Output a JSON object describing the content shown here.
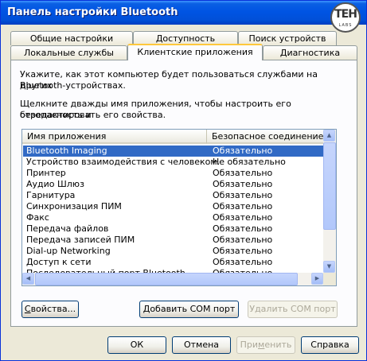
{
  "window": {
    "title": "Панель настройки Bluetooth"
  },
  "logo": {
    "text": "ТЕН",
    "subtext": "LABS"
  },
  "tabs_row1": [
    {
      "label": "Общие настройки"
    },
    {
      "label": "Доступность"
    },
    {
      "label": "Поиск устройств"
    }
  ],
  "tabs_row2": [
    {
      "label": "Локальные службы"
    },
    {
      "label": "Клиентские приложения",
      "active": true
    },
    {
      "label": "Диагностика"
    }
  ],
  "description": {
    "line1": "Укажите, как этот компьютер будет пользоваться службами на других",
    "line2": "Bluetooth-устройствах.",
    "line3": "Щелкните дважды имя приложения, чтобы настроить его безопасность и",
    "line4": "отредактировать его свойства."
  },
  "table": {
    "columns": [
      "Имя приложения",
      "Безопасное соединение"
    ],
    "rows": [
      {
        "name": "Bluetooth Imaging",
        "secure": "Обязательно",
        "selected": true
      },
      {
        "name": "Устройство взаимодействия с человеком.",
        "secure": "Не обязательно"
      },
      {
        "name": "Принтер",
        "secure": "Обязательно"
      },
      {
        "name": "Аудио Шлюз",
        "secure": "Обязательно"
      },
      {
        "name": "Гарнитура",
        "secure": "Обязательно"
      },
      {
        "name": "Синхронизация ПИМ",
        "secure": "Обязательно"
      },
      {
        "name": "Факс",
        "secure": "Обязательно"
      },
      {
        "name": "Передача файлов",
        "secure": "Обязательно"
      },
      {
        "name": "Передача записей ПИМ",
        "secure": "Обязательно"
      },
      {
        "name": "Dial-up Networking",
        "secure": "Обязательно"
      },
      {
        "name": "Доступ к сети",
        "secure": "Обязательно"
      },
      {
        "name": "Последовательный порт Bluetooth",
        "secure": "Обязательно"
      }
    ]
  },
  "panel_buttons": {
    "properties_underlined": "С",
    "properties_rest": "войства...",
    "add_com": "Добавить COM порт",
    "remove_com": "Удалить COM порт"
  },
  "dialog_buttons": {
    "ok": "ОК",
    "cancel": "Отмена",
    "apply_a": "При",
    "apply_u": "м",
    "apply_b": "енить",
    "help": "Справка"
  }
}
